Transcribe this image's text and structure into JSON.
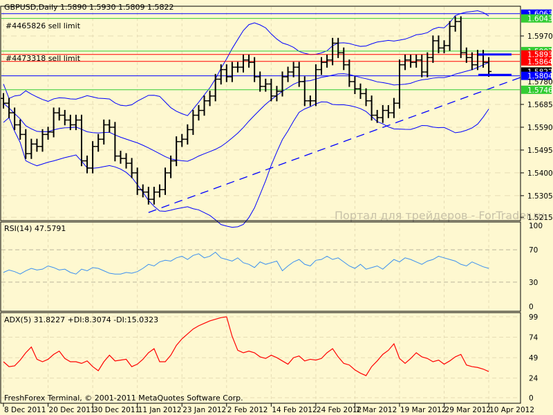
{
  "header": {
    "symbol_title": "GBPUSD,Daily  1.5890 1.5930 1.5809 1.5822",
    "rsi_title": "RSI(14) 47.5791",
    "adx_title": "ADX(5) 31.8227 +DI:8.3074 -DI:15.0323",
    "copyright": "FreshForex Terminal, © 2001-2011 MetaQuotes Software Corp.",
    "watermark": "Портал для трейдеров - ForTrader.ru"
  },
  "orders": [
    {
      "label": "#4465826 sell limit"
    },
    {
      "label": "#4473318 sell limit"
    }
  ],
  "colors": {
    "background": "#fef8d0",
    "bars": "#000000",
    "bands": "#0000ff",
    "rsi": "#3a8ff0",
    "adx": "#ff0000",
    "green": "#33cc33",
    "red": "#ff0000",
    "blue": "#0000ff",
    "grid": "#e6dcb4"
  },
  "chart_data": [
    {
      "type": "ohlc",
      "title": "GBPUSD,Daily",
      "ylim": [
        1.5215,
        1.608
      ],
      "price_ticks": [
        "1.5970",
        "1.5685",
        "1.5590",
        "1.5495",
        "1.5400",
        "1.5305",
        "1.5215"
      ],
      "x_ticks": [
        {
          "label": "8 Dec 2011",
          "bar": 0
        },
        {
          "label": "20 Dec 2011",
          "bar": 8
        },
        {
          "label": "30 Dec 2011",
          "bar": 16
        },
        {
          "label": "11 Jan 2012",
          "bar": 24
        },
        {
          "label": "23 Jan 2012",
          "bar": 32
        },
        {
          "label": "2 Feb 2012",
          "bar": 40
        },
        {
          "label": "14 Feb 2012",
          "bar": 48
        },
        {
          "label": "24 Feb 2012",
          "bar": 56
        },
        {
          "label": "7 Mar 2012",
          "bar": 63
        },
        {
          "label": "19 Mar 2012",
          "bar": 71
        },
        {
          "label": "29 Mar 2012",
          "bar": 79
        },
        {
          "label": "10 Apr 2012",
          "bar": 87
        }
      ],
      "levels": [
        {
          "price": "1.6063",
          "color": "#0000ff"
        },
        {
          "price": "1.6043",
          "color": "#33cc33"
        },
        {
          "price": "1.5907",
          "color": "#33cc33"
        },
        {
          "price": "1.5893",
          "color": "#ff0000"
        },
        {
          "price": "1.5864",
          "color": "#ff0000"
        },
        {
          "price": "1.5822",
          "color": "#000000"
        },
        {
          "price": "1.5804",
          "color": "#0000ff"
        },
        {
          "price": "1.5780",
          "color": null
        },
        {
          "price": "1.5746",
          "color": "#33cc33"
        }
      ],
      "trendline": {
        "from": {
          "bar": 26,
          "price": 1.5235
        },
        "to": {
          "bar": 93,
          "price": 1.58
        }
      },
      "close": [
        1.569,
        1.565,
        1.56,
        1.556,
        1.548,
        1.552,
        1.551,
        1.556,
        1.557,
        1.565,
        1.564,
        1.562,
        1.56,
        1.562,
        1.545,
        1.542,
        1.551,
        1.554,
        1.56,
        1.559,
        1.547,
        1.546,
        1.544,
        1.54,
        1.533,
        1.532,
        1.529,
        1.532,
        1.533,
        1.54,
        1.545,
        1.553,
        1.554,
        1.558,
        1.564,
        1.566,
        1.57,
        1.572,
        1.579,
        1.583,
        1.58,
        1.584,
        1.584,
        1.587,
        1.586,
        1.58,
        1.576,
        1.577,
        1.572,
        1.574,
        1.58,
        1.582,
        1.584,
        1.578,
        1.57,
        1.57,
        1.583,
        1.586,
        1.587,
        1.594,
        1.59,
        1.585,
        1.578,
        1.575,
        1.573,
        1.57,
        1.564,
        1.563,
        1.566,
        1.565,
        1.569,
        1.585,
        1.587,
        1.586,
        1.587,
        1.582,
        1.588,
        1.595,
        1.592,
        1.593,
        1.601,
        1.603,
        1.59,
        1.588,
        1.585,
        1.589,
        1.586,
        1.5822
      ]
    },
    {
      "type": "line",
      "title": "RSI(14) 47.5791",
      "ylim": [
        0,
        100
      ],
      "y_ticks": [
        "100",
        "70",
        "30",
        "0"
      ],
      "levels": [
        70,
        30
      ],
      "values": [
        42,
        45,
        43,
        40,
        44,
        47,
        45,
        46,
        50,
        48,
        45,
        46,
        42,
        40,
        46,
        44,
        48,
        47,
        44,
        41,
        40,
        40,
        42,
        41,
        43,
        47,
        52,
        50,
        55,
        57,
        56,
        60,
        62,
        58,
        63,
        65,
        60,
        62,
        67,
        60,
        58,
        56,
        60,
        54,
        52,
        48,
        55,
        52,
        54,
        56,
        44,
        50,
        55,
        58,
        52,
        50,
        57,
        58,
        62,
        58,
        60,
        55,
        50,
        47,
        52,
        46,
        48,
        50,
        46,
        52,
        58,
        55,
        60,
        58,
        55,
        52,
        56,
        58,
        62,
        60,
        58,
        56,
        52,
        50,
        55,
        52,
        49,
        47
      ]
    },
    {
      "type": "line",
      "title": "ADX(5) 31.8227 +DI:8.3074 -DI:15.0323",
      "ylim": [
        0,
        99
      ],
      "y_ticks": [
        "99",
        "74",
        "49",
        "24",
        "0"
      ],
      "values": [
        44,
        38,
        39,
        46,
        55,
        62,
        47,
        44,
        47,
        53,
        57,
        48,
        44,
        44,
        42,
        45,
        38,
        33,
        44,
        52,
        45,
        46,
        47,
        38,
        41,
        47,
        55,
        60,
        44,
        44,
        52,
        64,
        72,
        78,
        84,
        88,
        91,
        94,
        96,
        98,
        99,
        75,
        58,
        55,
        57,
        55,
        50,
        48,
        52,
        49,
        45,
        41,
        49,
        51,
        45,
        47,
        46,
        48,
        55,
        60,
        50,
        42,
        40,
        34,
        30,
        27,
        38,
        45,
        53,
        58,
        66,
        48,
        42,
        48,
        55,
        50,
        48,
        44,
        46,
        41,
        45,
        50,
        53,
        40,
        38,
        37,
        35,
        32
      ]
    }
  ]
}
